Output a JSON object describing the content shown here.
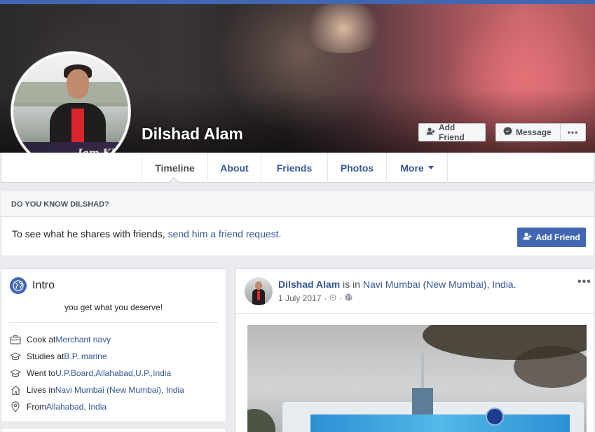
{
  "profile": {
    "name": "Dilshad Alam",
    "avatar_tag": "Iam Kh"
  },
  "cover_actions": {
    "add_friend": "Add Friend",
    "message": "Message",
    "more": "•••"
  },
  "tabs": [
    {
      "label": "Timeline"
    },
    {
      "label": "About"
    },
    {
      "label": "Friends"
    },
    {
      "label": "Photos"
    },
    {
      "label": "More"
    }
  ],
  "know_box": {
    "title": "DO YOU KNOW DILSHAD?",
    "text": "To see what he shares with friends, ",
    "link": "send him a friend request.",
    "button": "Add Friend"
  },
  "intro": {
    "title": "Intro",
    "bio": "you get what you deserve!",
    "items": [
      {
        "icon": "briefcase-icon",
        "prefix": "Cook at ",
        "link": "Merchant navy"
      },
      {
        "icon": "graduation-cap-icon",
        "prefix": "Studies at ",
        "link": "B.P. marine"
      },
      {
        "icon": "graduation-cap-icon",
        "prefix": "Went to ",
        "link": "U.P.Board,Allahabad,U.P.,India"
      },
      {
        "icon": "home-icon",
        "prefix": "Lives in ",
        "link": "Navi Mumbai (New Mumbai), India"
      },
      {
        "icon": "location-pin-icon",
        "prefix": "From ",
        "link": "Allahabad, India"
      }
    ]
  },
  "post": {
    "author": "Dilshad Alam",
    "is_in": " is in ",
    "place": "Navi Mumbai (New Mumbai), India.",
    "date": "1 July 2017",
    "separator": "·",
    "more": "•••"
  },
  "colors": {
    "brand_blue": "#4267b2",
    "link_blue": "#365899",
    "background": "#e9ebee"
  }
}
